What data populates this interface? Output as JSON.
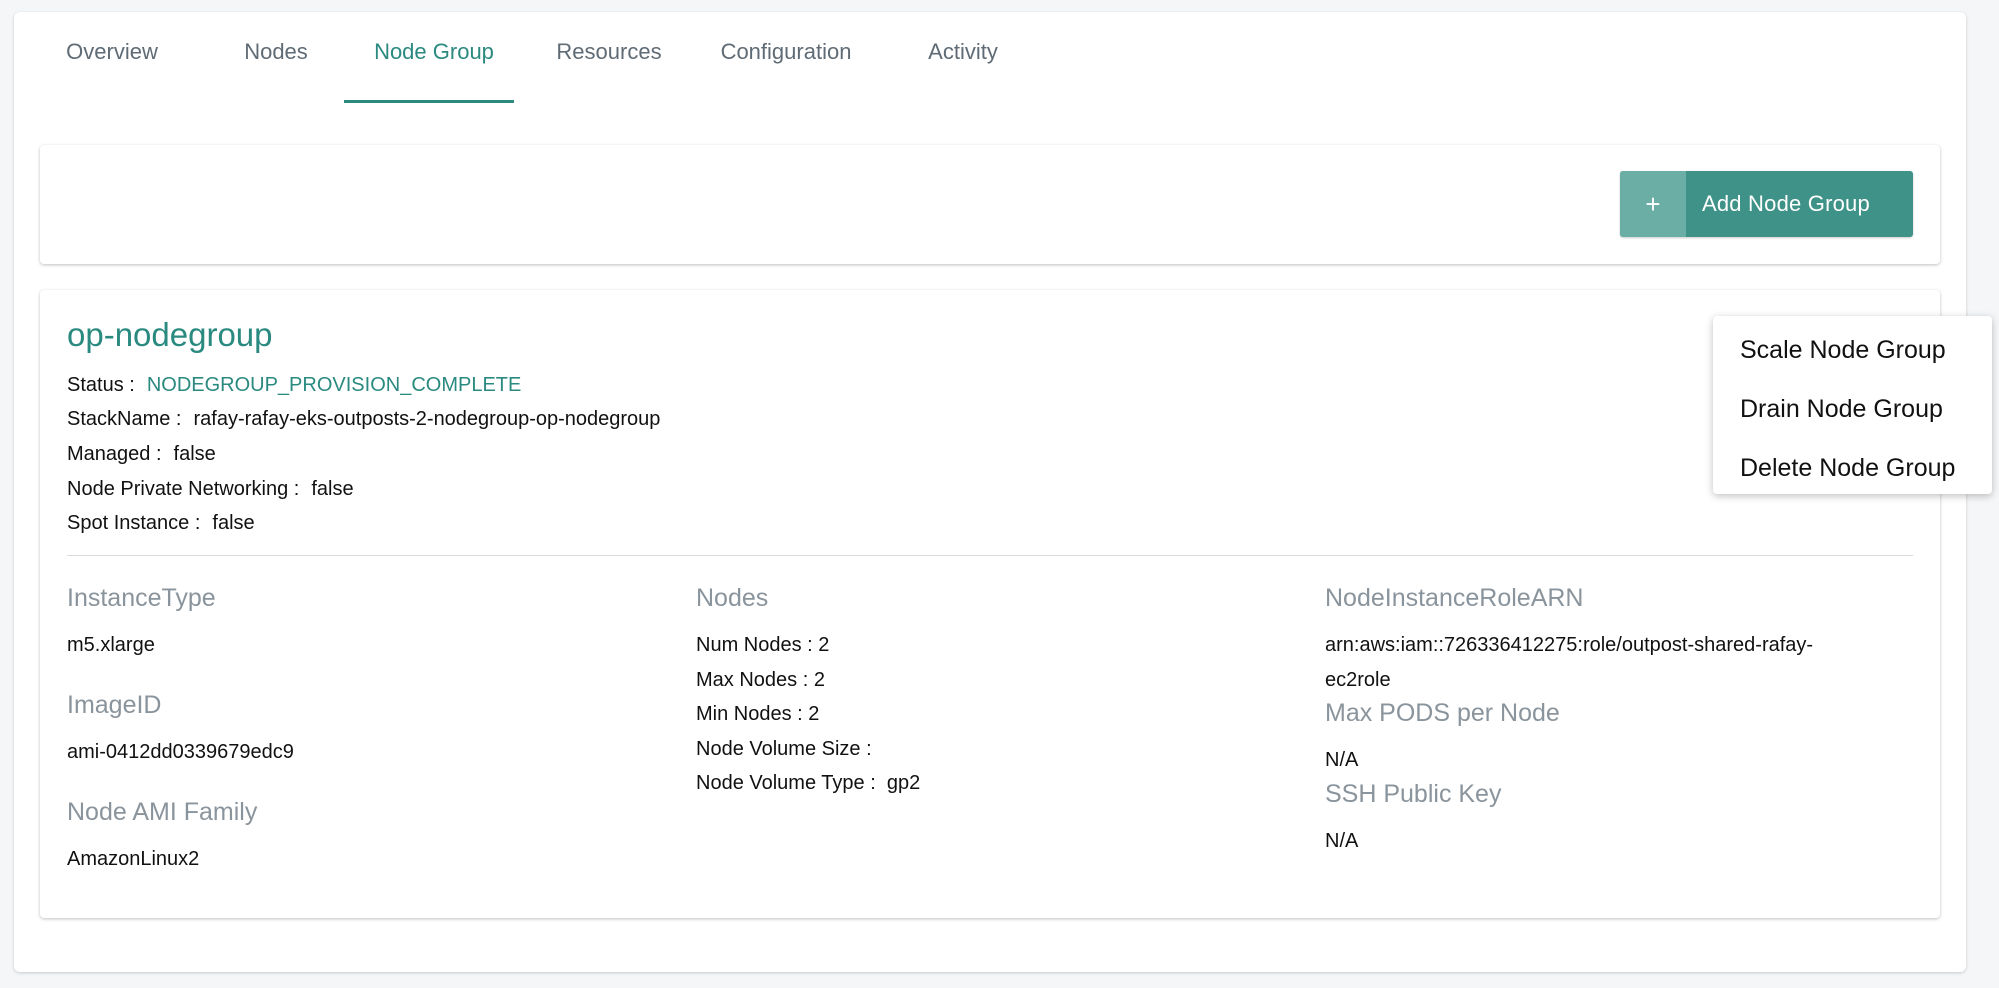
{
  "tabs": [
    {
      "label": "Overview"
    },
    {
      "label": "Nodes"
    },
    {
      "label": "Node Group"
    },
    {
      "label": "Resources"
    },
    {
      "label": "Configuration"
    },
    {
      "label": "Activity"
    }
  ],
  "active_tab": "Node Group",
  "toolbar": {
    "add_icon": "+",
    "add_label": "Add Node Group"
  },
  "nodegroup": {
    "name": "op-nodegroup",
    "status_key": "Status :",
    "status_value": "NODEGROUP_PROVISION_COMPLETE",
    "stackname_key": "StackName :",
    "stackname_value": "rafay-rafay-eks-outposts-2-nodegroup-op-nodegroup",
    "managed_key": "Managed :",
    "managed_value": "false",
    "private_net_key": "Node Private Networking :",
    "private_net_value": "false",
    "spot_key": "Spot Instance :",
    "spot_value": "false",
    "instance_type_head": "InstanceType",
    "instance_type_value": "m5.xlarge",
    "image_id_head": "ImageID",
    "image_id_value": "ami-0412dd0339679edc9",
    "ami_family_head": "Node AMI Family",
    "ami_family_value": "AmazonLinux2",
    "nodes_head": "Nodes",
    "num_nodes": "Num Nodes : 2",
    "max_nodes": "Max Nodes : 2",
    "min_nodes": "Min Nodes : 2",
    "volume_size": "Node Volume Size :",
    "volume_type_key": "Node Volume Type :",
    "volume_type_value": "gp2",
    "role_arn_head": "NodeInstanceRoleARN",
    "role_arn_line1": "arn:aws:iam::726336412275:role/outpost-shared-rafay-",
    "role_arn_line2": "ec2role",
    "max_pods_head": "Max PODS per Node",
    "max_pods_value": "N/A",
    "ssh_head": "SSH Public Key",
    "ssh_value": "N/A"
  },
  "menu": {
    "items": [
      {
        "label": "Scale Node Group"
      },
      {
        "label": "Drain Node Group"
      },
      {
        "label": "Delete Node Group"
      }
    ]
  },
  "colors": {
    "accent": "#2a8a80",
    "button": "#3f9287",
    "muted": "#8a949c"
  }
}
